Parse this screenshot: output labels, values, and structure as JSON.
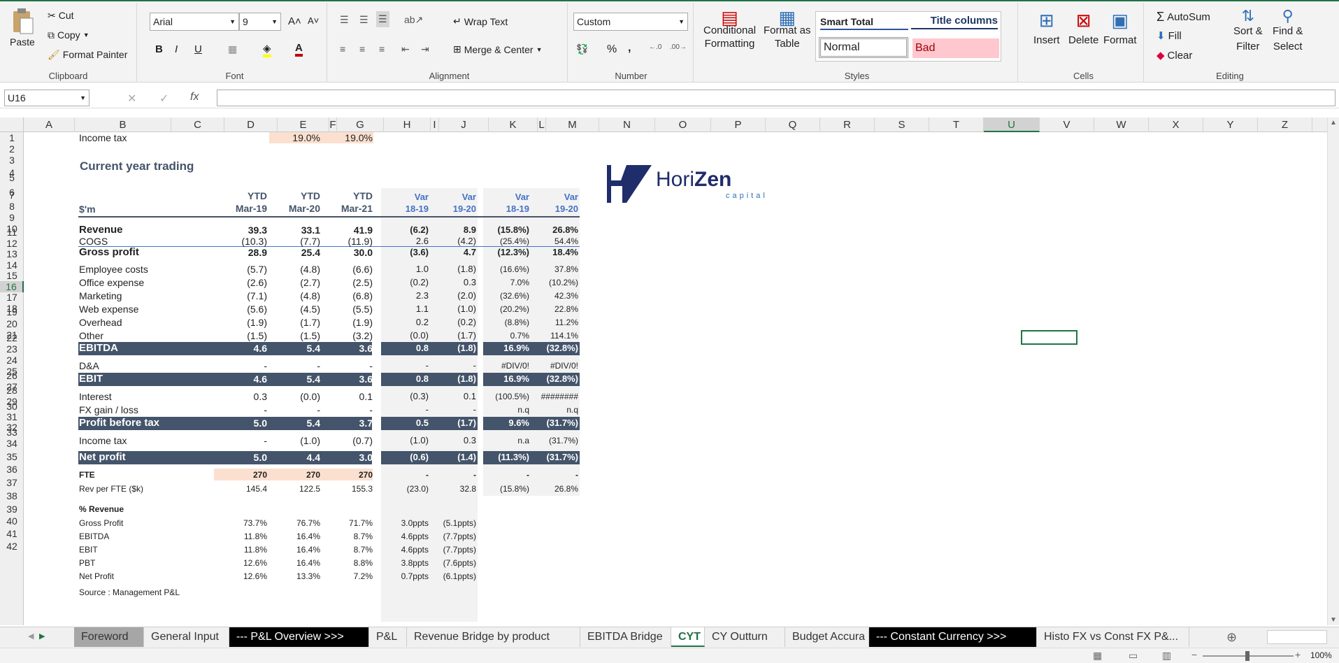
{
  "ribbon": {
    "clipboard": {
      "paste": "Paste",
      "cut": "Cut",
      "copy": "Copy",
      "format_painter": "Format Painter",
      "label": "Clipboard"
    },
    "font": {
      "name": "Arial",
      "size": "9",
      "label": "Font",
      "bold": "B",
      "italic": "I",
      "underline": "U"
    },
    "alignment": {
      "wrap": "Wrap Text",
      "merge": "Merge & Center",
      "label": "Alignment"
    },
    "number": {
      "format": "Custom",
      "percent": "%",
      "comma": ",",
      "label": "Number"
    },
    "styles": {
      "conditional": "Conditional",
      "conditional2": "Formatting",
      "format_table": "Format as",
      "format_table2": "Table",
      "smart_total": "Smart Total",
      "title_columns": "Title columns",
      "normal": "Normal",
      "bad": "Bad",
      "label": "Styles"
    },
    "cells": {
      "insert": "Insert",
      "delete": "Delete",
      "format": "Format",
      "label": "Cells"
    },
    "editing": {
      "autosum": "AutoSum",
      "fill": "Fill",
      "clear": "Clear",
      "sort": "Sort &",
      "sort2": "Filter",
      "find": "Find &",
      "find2": "Select",
      "label": "Editing"
    }
  },
  "formula_bar": {
    "name_box": "U16",
    "fx": "fx",
    "value": ""
  },
  "columns": [
    "A",
    "B",
    "C",
    "D",
    "E",
    "F",
    "G",
    "H",
    "I",
    "J",
    "K",
    "L",
    "M",
    "N",
    "O",
    "P",
    "Q",
    "R",
    "S",
    "T",
    "U",
    "V",
    "W",
    "X",
    "Y",
    "Z"
  ],
  "rows": [
    "1",
    "2",
    "3",
    "4",
    "5",
    "6",
    "7",
    "8",
    "9",
    "10",
    "11",
    "12",
    "13",
    "14",
    "15",
    "16",
    "17",
    "18",
    "19",
    "20",
    "21",
    "22",
    "23",
    "24",
    "25",
    "26",
    "27",
    "28",
    "29",
    "30",
    "31",
    "32",
    "33",
    "34",
    "35",
    "36",
    "37",
    "38",
    "39",
    "40",
    "41",
    "42"
  ],
  "logo": {
    "text1": "Hori",
    "text2": "Zen",
    "sub": "capital"
  },
  "sheet": {
    "tax_label": "Income tax",
    "tax_d": "19.0%",
    "tax_e": "19.0%",
    "title": "Current year trading",
    "hdr": {
      "unit": "$'m",
      "c1": "YTD",
      "c2": "Mar-19",
      "d1": "YTD",
      "d2": "Mar-20",
      "e1": "YTD",
      "e2": "Mar-21",
      "g1": "Var",
      "g2": "18-19",
      "h1": "Var",
      "h2": "19-20",
      "j1": "Var",
      "j2": "18-19",
      "k1": "Var",
      "k2": "19-20"
    },
    "rows": [
      {
        "r": 7,
        "label": "Revenue",
        "v": [
          "39.3",
          "33.1",
          "41.9",
          "(6.2)",
          "8.9",
          "(15.8%)",
          "26.8%"
        ],
        "style": "bold"
      },
      {
        "r": 8,
        "label": "COGS",
        "v": [
          "(10.3)",
          "(7.7)",
          "(11.9)",
          "2.6",
          "(4.2)",
          "(25.4%)",
          "54.4%"
        ],
        "style": "normal"
      },
      {
        "r": 9,
        "label": "Gross profit",
        "v": [
          "28.9",
          "25.4",
          "30.0",
          "(3.6)",
          "4.7",
          "(12.3%)",
          "18.4%"
        ],
        "style": "bold"
      },
      {
        "r": 11,
        "label": "Employee costs",
        "v": [
          "(5.7)",
          "(4.8)",
          "(6.6)",
          "1.0",
          "(1.8)",
          "(16.6%)",
          "37.8%"
        ],
        "style": "normal"
      },
      {
        "r": 12,
        "label": "Office expense",
        "v": [
          "(2.6)",
          "(2.7)",
          "(2.5)",
          "(0.2)",
          "0.3",
          "7.0%",
          "(10.2%)"
        ],
        "style": "normal"
      },
      {
        "r": 13,
        "label": "Marketing",
        "v": [
          "(7.1)",
          "(4.8)",
          "(6.8)",
          "2.3",
          "(2.0)",
          "(32.6%)",
          "42.3%"
        ],
        "style": "normal"
      },
      {
        "r": 14,
        "label": "Web expense",
        "v": [
          "(5.6)",
          "(4.5)",
          "(5.5)",
          "1.1",
          "(1.0)",
          "(20.2%)",
          "22.8%"
        ],
        "style": "normal"
      },
      {
        "r": 15,
        "label": "Overhead",
        "v": [
          "(1.9)",
          "(1.7)",
          "(1.9)",
          "0.2",
          "(0.2)",
          "(8.8%)",
          "11.2%"
        ],
        "style": "normal"
      },
      {
        "r": 16,
        "label": "Other",
        "v": [
          "(1.5)",
          "(1.5)",
          "(3.2)",
          "(0.0)",
          "(1.7)",
          "0.7%",
          "114.1%"
        ],
        "style": "normal"
      },
      {
        "r": 17,
        "label": "EBITDA",
        "v": [
          "4.6",
          "5.4",
          "3.6",
          "0.8",
          "(1.8)",
          "16.9%",
          "(32.8%)"
        ],
        "style": "band"
      },
      {
        "r": 19,
        "label": "D&A",
        "v": [
          "-",
          "-",
          "-",
          "-",
          "-",
          "#DIV/0!",
          "#DIV/0!"
        ],
        "style": "normal"
      },
      {
        "r": 20,
        "label": "EBIT",
        "v": [
          "4.6",
          "5.4",
          "3.6",
          "0.8",
          "(1.8)",
          "16.9%",
          "(32.8%)"
        ],
        "style": "band"
      },
      {
        "r": 22,
        "label": "Interest",
        "v": [
          "0.3",
          "(0.0)",
          "0.1",
          "(0.3)",
          "0.1",
          "(100.5%)",
          "########"
        ],
        "style": "normal"
      },
      {
        "r": 23,
        "label": "FX gain / loss",
        "v": [
          "-",
          "-",
          "-",
          "-",
          "-",
          "n.q",
          "n.q"
        ],
        "style": "normal"
      },
      {
        "r": 24,
        "label": "Profit before tax",
        "v": [
          "5.0",
          "5.4",
          "3.7",
          "0.5",
          "(1.7)",
          "9.6%",
          "(31.7%)"
        ],
        "style": "band"
      },
      {
        "r": 26,
        "label": "Income tax",
        "v": [
          "-",
          "(1.0)",
          "(0.7)",
          "(1.0)",
          "0.3",
          "n.a",
          "(31.7%)"
        ],
        "style": "normal"
      },
      {
        "r": 28,
        "label": "Net profit",
        "v": [
          "5.0",
          "4.4",
          "3.0",
          "(0.6)",
          "(1.4)",
          "(11.3%)",
          "(31.7%)"
        ],
        "style": "band"
      },
      {
        "r": 30,
        "label": "FTE",
        "v": [
          "270",
          "270",
          "270",
          "-",
          "-",
          "-",
          "-"
        ],
        "style": "fte"
      },
      {
        "r": 31,
        "label": "Rev per FTE ($k)",
        "v": [
          "145.4",
          "122.5",
          "155.3",
          "(23.0)",
          "32.8",
          "(15.8%)",
          "26.8%"
        ],
        "style": "small"
      }
    ],
    "pct_title": "% Revenue",
    "pct_rows": [
      {
        "r": 34,
        "label": "Gross Profit",
        "v": [
          "73.7%",
          "76.7%",
          "71.7%",
          "3.0ppts",
          "(5.1ppts)"
        ]
      },
      {
        "r": 35,
        "label": "EBITDA",
        "v": [
          "11.8%",
          "16.4%",
          "8.7%",
          "4.6ppts",
          "(7.7ppts)"
        ]
      },
      {
        "r": 36,
        "label": "EBIT",
        "v": [
          "11.8%",
          "16.4%",
          "8.7%",
          "4.6ppts",
          "(7.7ppts)"
        ]
      },
      {
        "r": 37,
        "label": "PBT",
        "v": [
          "12.6%",
          "16.4%",
          "8.8%",
          "3.8ppts",
          "(7.6ppts)"
        ]
      },
      {
        "r": 38,
        "label": "Net Profit",
        "v": [
          "12.6%",
          "13.3%",
          "7.2%",
          "0.7ppts",
          "(6.1ppts)"
        ]
      }
    ],
    "source": "Source : Management P&L"
  },
  "tabs": [
    "Foreword",
    "General Input",
    "--- P&L Overview >>>",
    "P&L",
    "Revenue Bridge by product",
    "EBITDA Bridge",
    "CYT",
    "CY Outturn",
    "Budget Accura",
    "--- Constant Currency >>>",
    "Histo FX vs Const FX P&..."
  ],
  "active_tab": "CYT",
  "status": {
    "zoom": "100%"
  }
}
